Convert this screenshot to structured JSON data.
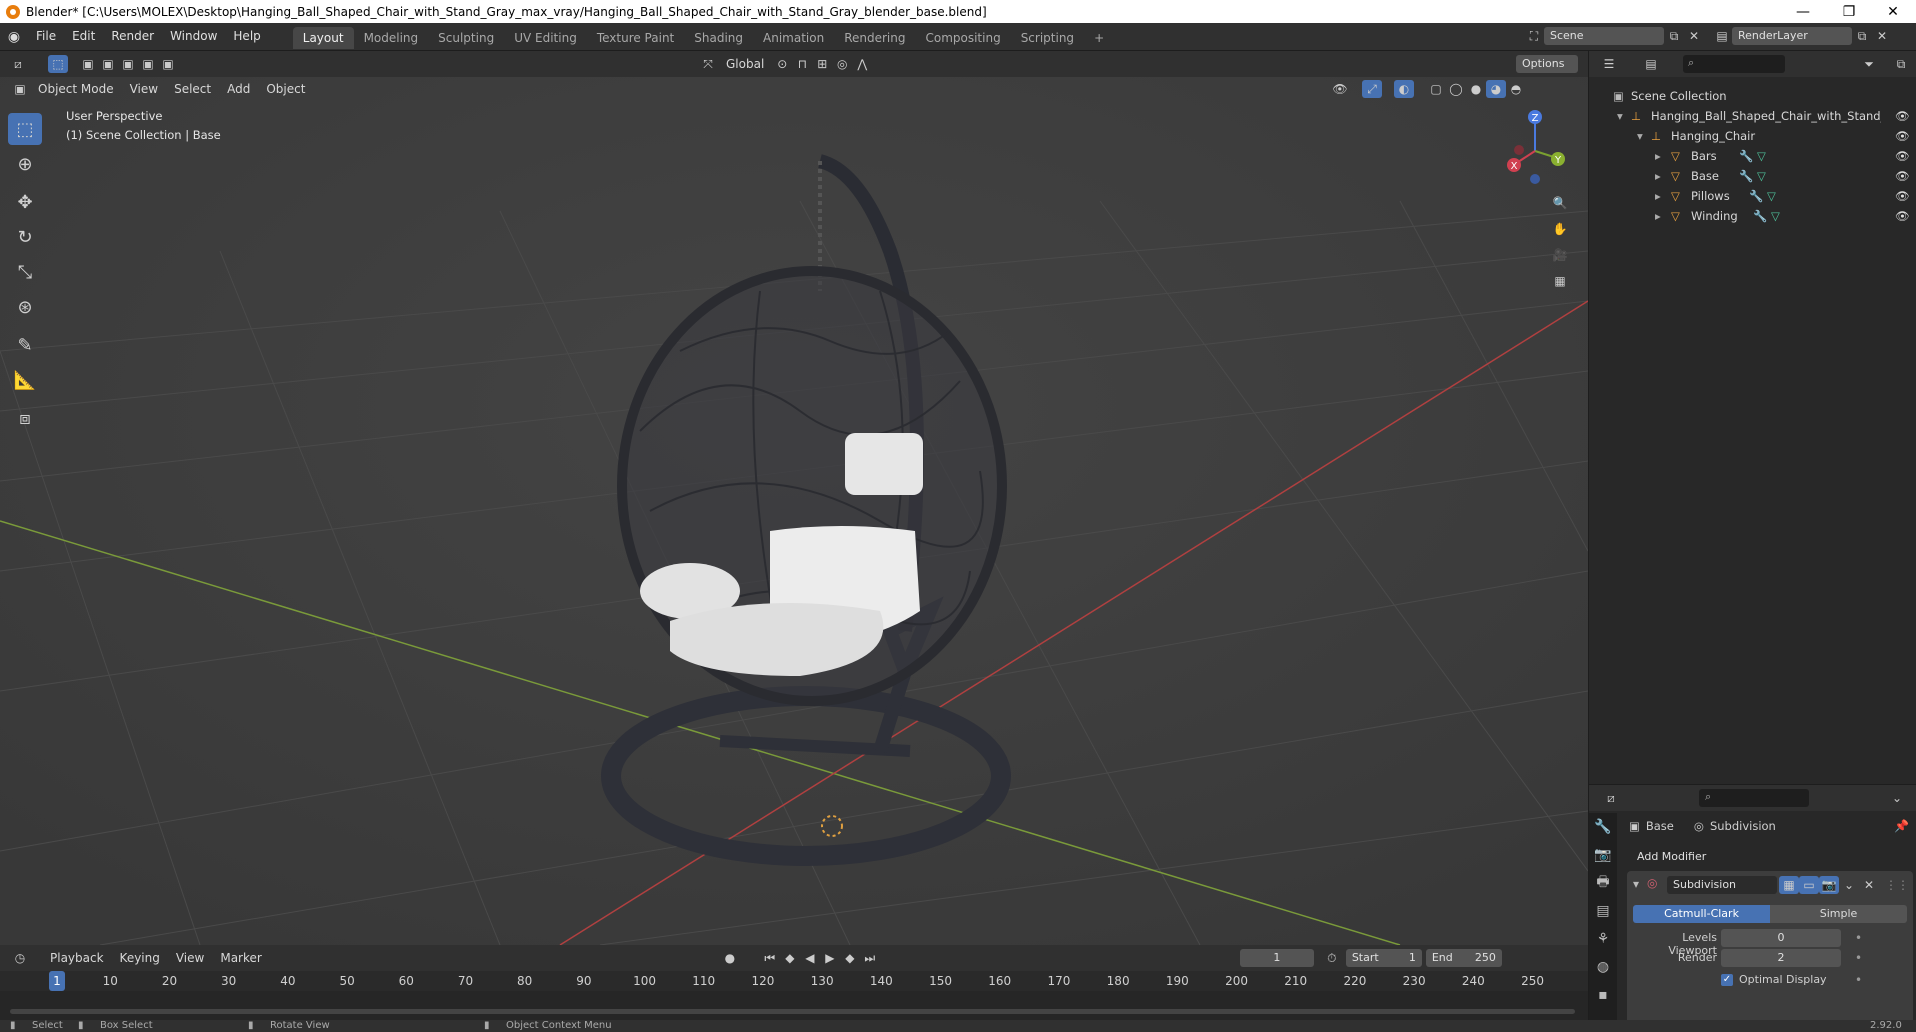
{
  "window": {
    "title": "Blender* [C:\\Users\\MOLEX\\Desktop\\Hanging_Ball_Shaped_Chair_with_Stand_Gray_max_vray/Hanging_Ball_Shaped_Chair_with_Stand_Gray_blender_base.blend]",
    "minimize": "—",
    "maximize": "❐",
    "close": "✕"
  },
  "menu": [
    "File",
    "Edit",
    "Render",
    "Window",
    "Help"
  ],
  "workspaces": [
    "Layout",
    "Modeling",
    "Sculpting",
    "UV Editing",
    "Texture Paint",
    "Shading",
    "Animation",
    "Rendering",
    "Compositing",
    "Scripting"
  ],
  "workspace_add": "+",
  "scene": {
    "name": "Scene",
    "render_layer": "RenderLayer"
  },
  "viewport_header": {
    "transform_orientation": "Global",
    "options": "Options",
    "mode": "Object Mode",
    "menus": [
      "View",
      "Select",
      "Add",
      "Object"
    ]
  },
  "viewport_overlay": {
    "perspective": "User Perspective",
    "collection": "(1) Scene Collection | Base"
  },
  "gizmo": {
    "x": "X",
    "y": "Y",
    "z": "Z"
  },
  "outliner": {
    "search_placeholder": "",
    "root": "Scene Collection",
    "collection": "Hanging_Ball_Shaped_Chair_with_Stand_Gra",
    "empty": "Hanging_Chair",
    "objects": [
      "Bars",
      "Base",
      "Pillows",
      "Winding"
    ]
  },
  "properties": {
    "object": "Base",
    "modifier_breadcrumb": "Subdivision",
    "add_modifier": "Add Modifier",
    "modifier_name": "Subdivision",
    "type_catmull": "Catmull-Clark",
    "type_simple": "Simple",
    "levels_viewport_label": "Levels Viewport",
    "levels_viewport_value": "0",
    "render_label": "Render",
    "render_value": "2",
    "optimal_display": "Optimal Display"
  },
  "timeline": {
    "menus": [
      "Playback",
      "Keying",
      "View",
      "Marker"
    ],
    "current_frame": "1",
    "start_label": "Start",
    "start": "1",
    "end_label": "End",
    "end": "250",
    "ticks": [
      "1",
      "10",
      "20",
      "30",
      "40",
      "50",
      "60",
      "70",
      "80",
      "90",
      "100",
      "110",
      "120",
      "130",
      "140",
      "150",
      "160",
      "170",
      "180",
      "190",
      "200",
      "210",
      "220",
      "230",
      "240",
      "250"
    ]
  },
  "statusbar": {
    "select": "Select",
    "box_select": "Box Select",
    "rotate_view": "Rotate View",
    "context_menu": "Object Context Menu",
    "version": "2.92.0"
  }
}
